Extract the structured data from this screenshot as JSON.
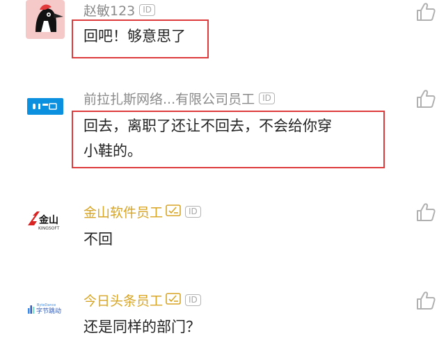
{
  "comments": [
    {
      "username": "赵敏123",
      "id_badge": "ID",
      "text_lines": [
        "回吧！够意思了"
      ],
      "avatar": "woodpecker-avatar"
    },
    {
      "username": "前拉扎斯网络...有限公司员工",
      "id_badge": "ID",
      "text_lines": [
        "回去，离职了还让不回去，不会给你穿",
        "小鞋的。"
      ],
      "avatar": "ele-me-logo"
    },
    {
      "username": "金山软件员工",
      "id_badge": "ID",
      "text_lines": [
        "不回"
      ],
      "avatar": "kingsoft-logo",
      "logo_main": "金山",
      "logo_sub": "KINGSOFT"
    },
    {
      "username": "今日头条员工",
      "id_badge": "ID",
      "text_lines": [
        "还是同样的部门？"
      ],
      "avatar": "bytedance-logo",
      "logo_sub_en": "ByteDance",
      "logo_main": "字节跳动"
    }
  ],
  "colors": {
    "highlight": "#dd3b3b",
    "verified_name": "#d8a424",
    "plain_name": "#8a8a8a",
    "like_icon": "#b0b0b0"
  }
}
